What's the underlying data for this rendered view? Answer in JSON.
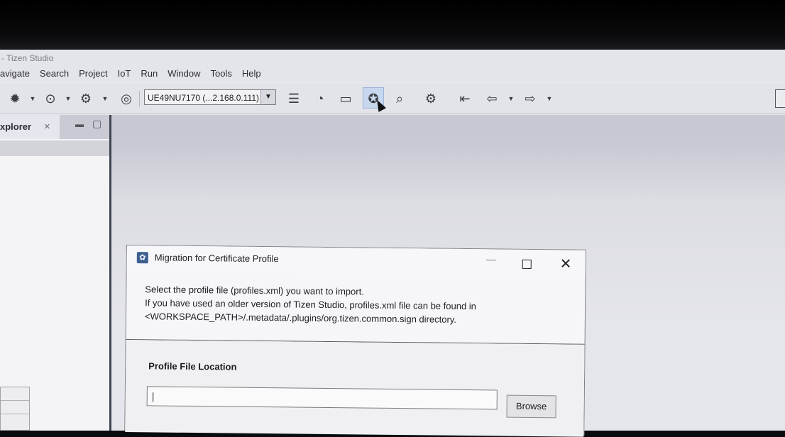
{
  "app": {
    "title": "- Tizen Studio"
  },
  "menu": [
    "avigate",
    "Search",
    "Project",
    "IoT",
    "Run",
    "Window",
    "Tools",
    "Help"
  ],
  "toolbar": {
    "device_combo": "UE49NU7170 (...2.168.0.111)",
    "combo_arrow": "▼",
    "icons": [
      "bug-icon",
      "run-icon",
      "launch-config-icon",
      "stop-icon",
      "list-icon",
      "monitor-icon",
      "archive-icon",
      "certificate-icon",
      "search-log-icon",
      "settings-icon",
      "back-to-start-icon",
      "back-icon",
      "forward-icon"
    ]
  },
  "explorer": {
    "tab_label": "xplorer",
    "close_glyph": "×"
  },
  "dialog": {
    "title": "Migration for Certificate Profile",
    "message_line1": "Select the profile file (profiles.xml) you want to import.",
    "message_line2": "If you have used an older version of Tizen Studio, profiles.xml file can be found in",
    "message_line3": "<WORKSPACE_PATH>/.metadata/.plugins/org.tizen.common.sign directory.",
    "location_label": "Profile File Location",
    "location_value": "",
    "browse_label": "Browse",
    "close_glyph": "✕",
    "min_glyph": "—"
  }
}
